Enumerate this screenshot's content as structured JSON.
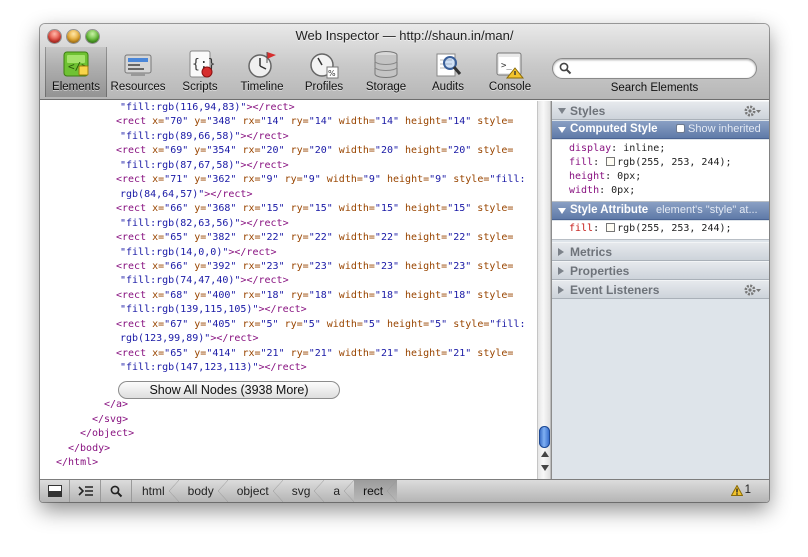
{
  "window": {
    "title": "Web Inspector — http://shaun.in/man/"
  },
  "toolbar": {
    "items": [
      {
        "label": "Elements",
        "icon": "elements-icon",
        "selected": true
      },
      {
        "label": "Resources",
        "icon": "resources-icon"
      },
      {
        "label": "Scripts",
        "icon": "scripts-icon"
      },
      {
        "label": "Timeline",
        "icon": "timeline-icon"
      },
      {
        "label": "Profiles",
        "icon": "profiles-icon"
      },
      {
        "label": "Storage",
        "icon": "storage-icon"
      },
      {
        "label": "Audits",
        "icon": "audits-icon"
      },
      {
        "label": "Console",
        "icon": "console-icon"
      }
    ],
    "search_label": "Search Elements",
    "search_value": ""
  },
  "dom": {
    "lines": [
      {
        "indent": 0,
        "parts": [
          [
            "av",
            "\"fill:rgb(116,94,83)\""
          ],
          [
            "tag",
            "></rect>"
          ]
        ]
      },
      {
        "indent": 1,
        "parts": [
          [
            "tag",
            "<rect "
          ],
          [
            "an",
            "x="
          ],
          [
            "av",
            "\"70\" "
          ],
          [
            "an",
            "y="
          ],
          [
            "av",
            "\"348\" "
          ],
          [
            "an",
            "rx="
          ],
          [
            "av",
            "\"14\" "
          ],
          [
            "an",
            "ry="
          ],
          [
            "av",
            "\"14\" "
          ],
          [
            "an",
            "width="
          ],
          [
            "av",
            "\"14\" "
          ],
          [
            "an",
            "height="
          ],
          [
            "av",
            "\"14\" "
          ],
          [
            "an",
            "style="
          ]
        ]
      },
      {
        "indent": 0,
        "parts": [
          [
            "av",
            "\"fill:rgb(89,66,58)\""
          ],
          [
            "tag",
            "></rect>"
          ]
        ]
      },
      {
        "indent": 1,
        "parts": [
          [
            "tag",
            "<rect "
          ],
          [
            "an",
            "x="
          ],
          [
            "av",
            "\"69\" "
          ],
          [
            "an",
            "y="
          ],
          [
            "av",
            "\"354\" "
          ],
          [
            "an",
            "rx="
          ],
          [
            "av",
            "\"20\" "
          ],
          [
            "an",
            "ry="
          ],
          [
            "av",
            "\"20\" "
          ],
          [
            "an",
            "width="
          ],
          [
            "av",
            "\"20\" "
          ],
          [
            "an",
            "height="
          ],
          [
            "av",
            "\"20\" "
          ],
          [
            "an",
            "style="
          ]
        ]
      },
      {
        "indent": 0,
        "parts": [
          [
            "av",
            "\"fill:rgb(87,67,58)\""
          ],
          [
            "tag",
            "></rect>"
          ]
        ]
      },
      {
        "indent": 1,
        "parts": [
          [
            "tag",
            "<rect "
          ],
          [
            "an",
            "x="
          ],
          [
            "av",
            "\"71\" "
          ],
          [
            "an",
            "y="
          ],
          [
            "av",
            "\"362\" "
          ],
          [
            "an",
            "rx="
          ],
          [
            "av",
            "\"9\" "
          ],
          [
            "an",
            "ry="
          ],
          [
            "av",
            "\"9\" "
          ],
          [
            "an",
            "width="
          ],
          [
            "av",
            "\"9\" "
          ],
          [
            "an",
            "height="
          ],
          [
            "av",
            "\"9\" "
          ],
          [
            "an",
            "style="
          ],
          [
            "av",
            "\"fill:"
          ]
        ]
      },
      {
        "indent": 0,
        "parts": [
          [
            "av",
            "rgb(84,64,57)\""
          ],
          [
            "tag",
            "></rect>"
          ]
        ]
      },
      {
        "indent": 1,
        "parts": [
          [
            "tag",
            "<rect "
          ],
          [
            "an",
            "x="
          ],
          [
            "av",
            "\"66\" "
          ],
          [
            "an",
            "y="
          ],
          [
            "av",
            "\"368\" "
          ],
          [
            "an",
            "rx="
          ],
          [
            "av",
            "\"15\" "
          ],
          [
            "an",
            "ry="
          ],
          [
            "av",
            "\"15\" "
          ],
          [
            "an",
            "width="
          ],
          [
            "av",
            "\"15\" "
          ],
          [
            "an",
            "height="
          ],
          [
            "av",
            "\"15\" "
          ],
          [
            "an",
            "style="
          ]
        ]
      },
      {
        "indent": 0,
        "parts": [
          [
            "av",
            "\"fill:rgb(82,63,56)\""
          ],
          [
            "tag",
            "></rect>"
          ]
        ]
      },
      {
        "indent": 1,
        "parts": [
          [
            "tag",
            "<rect "
          ],
          [
            "an",
            "x="
          ],
          [
            "av",
            "\"65\" "
          ],
          [
            "an",
            "y="
          ],
          [
            "av",
            "\"382\" "
          ],
          [
            "an",
            "rx="
          ],
          [
            "av",
            "\"22\" "
          ],
          [
            "an",
            "ry="
          ],
          [
            "av",
            "\"22\" "
          ],
          [
            "an",
            "width="
          ],
          [
            "av",
            "\"22\" "
          ],
          [
            "an",
            "height="
          ],
          [
            "av",
            "\"22\" "
          ],
          [
            "an",
            "style="
          ]
        ]
      },
      {
        "indent": 0,
        "parts": [
          [
            "av",
            "\"fill:rgb(14,0,0)\""
          ],
          [
            "tag",
            "></rect>"
          ]
        ]
      },
      {
        "indent": 1,
        "parts": [
          [
            "tag",
            "<rect "
          ],
          [
            "an",
            "x="
          ],
          [
            "av",
            "\"66\" "
          ],
          [
            "an",
            "y="
          ],
          [
            "av",
            "\"392\" "
          ],
          [
            "an",
            "rx="
          ],
          [
            "av",
            "\"23\" "
          ],
          [
            "an",
            "ry="
          ],
          [
            "av",
            "\"23\" "
          ],
          [
            "an",
            "width="
          ],
          [
            "av",
            "\"23\" "
          ],
          [
            "an",
            "height="
          ],
          [
            "av",
            "\"23\" "
          ],
          [
            "an",
            "style="
          ]
        ]
      },
      {
        "indent": 0,
        "parts": [
          [
            "av",
            "\"fill:rgb(74,47,40)\""
          ],
          [
            "tag",
            "></rect>"
          ]
        ]
      },
      {
        "indent": 1,
        "parts": [
          [
            "tag",
            "<rect "
          ],
          [
            "an",
            "x="
          ],
          [
            "av",
            "\"68\" "
          ],
          [
            "an",
            "y="
          ],
          [
            "av",
            "\"400\" "
          ],
          [
            "an",
            "rx="
          ],
          [
            "av",
            "\"18\" "
          ],
          [
            "an",
            "ry="
          ],
          [
            "av",
            "\"18\" "
          ],
          [
            "an",
            "width="
          ],
          [
            "av",
            "\"18\" "
          ],
          [
            "an",
            "height="
          ],
          [
            "av",
            "\"18\" "
          ],
          [
            "an",
            "style="
          ]
        ]
      },
      {
        "indent": 0,
        "parts": [
          [
            "av",
            "\"fill:rgb(139,115,105)\""
          ],
          [
            "tag",
            "></rect>"
          ]
        ]
      },
      {
        "indent": 1,
        "parts": [
          [
            "tag",
            "<rect "
          ],
          [
            "an",
            "x="
          ],
          [
            "av",
            "\"67\" "
          ],
          [
            "an",
            "y="
          ],
          [
            "av",
            "\"405\" "
          ],
          [
            "an",
            "rx="
          ],
          [
            "av",
            "\"5\" "
          ],
          [
            "an",
            "ry="
          ],
          [
            "av",
            "\"5\" "
          ],
          [
            "an",
            "width="
          ],
          [
            "av",
            "\"5\" "
          ],
          [
            "an",
            "height="
          ],
          [
            "av",
            "\"5\" "
          ],
          [
            "an",
            "style="
          ],
          [
            "av",
            "\"fill:"
          ]
        ]
      },
      {
        "indent": 0,
        "parts": [
          [
            "av",
            "rgb(123,99,89)\""
          ],
          [
            "tag",
            "></rect>"
          ]
        ]
      },
      {
        "indent": 1,
        "parts": [
          [
            "tag",
            "<rect "
          ],
          [
            "an",
            "x="
          ],
          [
            "av",
            "\"65\" "
          ],
          [
            "an",
            "y="
          ],
          [
            "av",
            "\"414\" "
          ],
          [
            "an",
            "rx="
          ],
          [
            "av",
            "\"21\" "
          ],
          [
            "an",
            "ry="
          ],
          [
            "av",
            "\"21\" "
          ],
          [
            "an",
            "width="
          ],
          [
            "av",
            "\"21\" "
          ],
          [
            "an",
            "height="
          ],
          [
            "av",
            "\"21\" "
          ],
          [
            "an",
            "style="
          ]
        ]
      },
      {
        "indent": 0,
        "parts": [
          [
            "av",
            "\"fill:rgb(147,123,113)\""
          ],
          [
            "tag",
            "></rect>"
          ]
        ]
      }
    ],
    "show_all_label": "Show All Nodes (3938 More)",
    "closing": [
      "</a>",
      "</svg>",
      "</object>",
      "</body>",
      "</html>"
    ]
  },
  "sidebar": {
    "styles_label": "Styles",
    "computed_label": "Computed Style",
    "show_inherited_label": "Show inherited",
    "computed_props": [
      {
        "name": "display",
        "value": "inline;"
      },
      {
        "name": "fill",
        "value": "rgb(255, 253, 244);",
        "swatch": "#fffdf4"
      },
      {
        "name": "height",
        "value": "0px;"
      },
      {
        "name": "width",
        "value": "0px;"
      }
    ],
    "style_attr_label": "Style Attribute",
    "style_attr_aside": "element's \"style\" at...",
    "style_attr_props": [
      {
        "name": "fill",
        "value": "rgb(255, 253, 244);",
        "swatch": "#fffdf4"
      }
    ],
    "metrics_label": "Metrics",
    "properties_label": "Properties",
    "event_listeners_label": "Event Listeners"
  },
  "statusbar": {
    "breadcrumbs": [
      "html",
      "body",
      "object",
      "svg",
      "a",
      "rect"
    ],
    "selected_crumb": "rect",
    "warning_count": "1"
  },
  "colors": {
    "tag": "#881280",
    "attr_name": "#994500",
    "attr_value": "#1a1aa6",
    "selection_header": "#6b84b0"
  }
}
